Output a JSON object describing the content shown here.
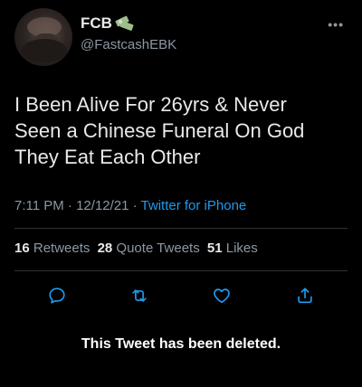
{
  "author": {
    "display_name": "FCB",
    "display_name_emoji": "money-with-wings-icon",
    "handle": "@FastcashEBK"
  },
  "tweet": {
    "text": "I Been Alive For 26yrs & Never\nSeen a Chinese Funeral On God\nThey Eat Each Other",
    "time": "7:11 PM",
    "separator1": " · ",
    "date": "12/12/21",
    "separator2": " · ",
    "source": "Twitter for iPhone"
  },
  "stats": {
    "retweets_count": "16",
    "retweets_label": "Retweets",
    "quote_tweets_count": "28",
    "quote_tweets_label": "Quote Tweets",
    "likes_count": "51",
    "likes_label": "Likes"
  },
  "actions": [
    "reply-icon",
    "retweet-icon",
    "like-icon",
    "share-icon"
  ],
  "notice": {
    "deleted_text": "This Tweet has been deleted."
  },
  "colors": {
    "background": "#000000",
    "text": "#e7e9ea",
    "secondary": "#8b98a5",
    "link": "#1d9bf0",
    "divider": "#2f3336"
  }
}
